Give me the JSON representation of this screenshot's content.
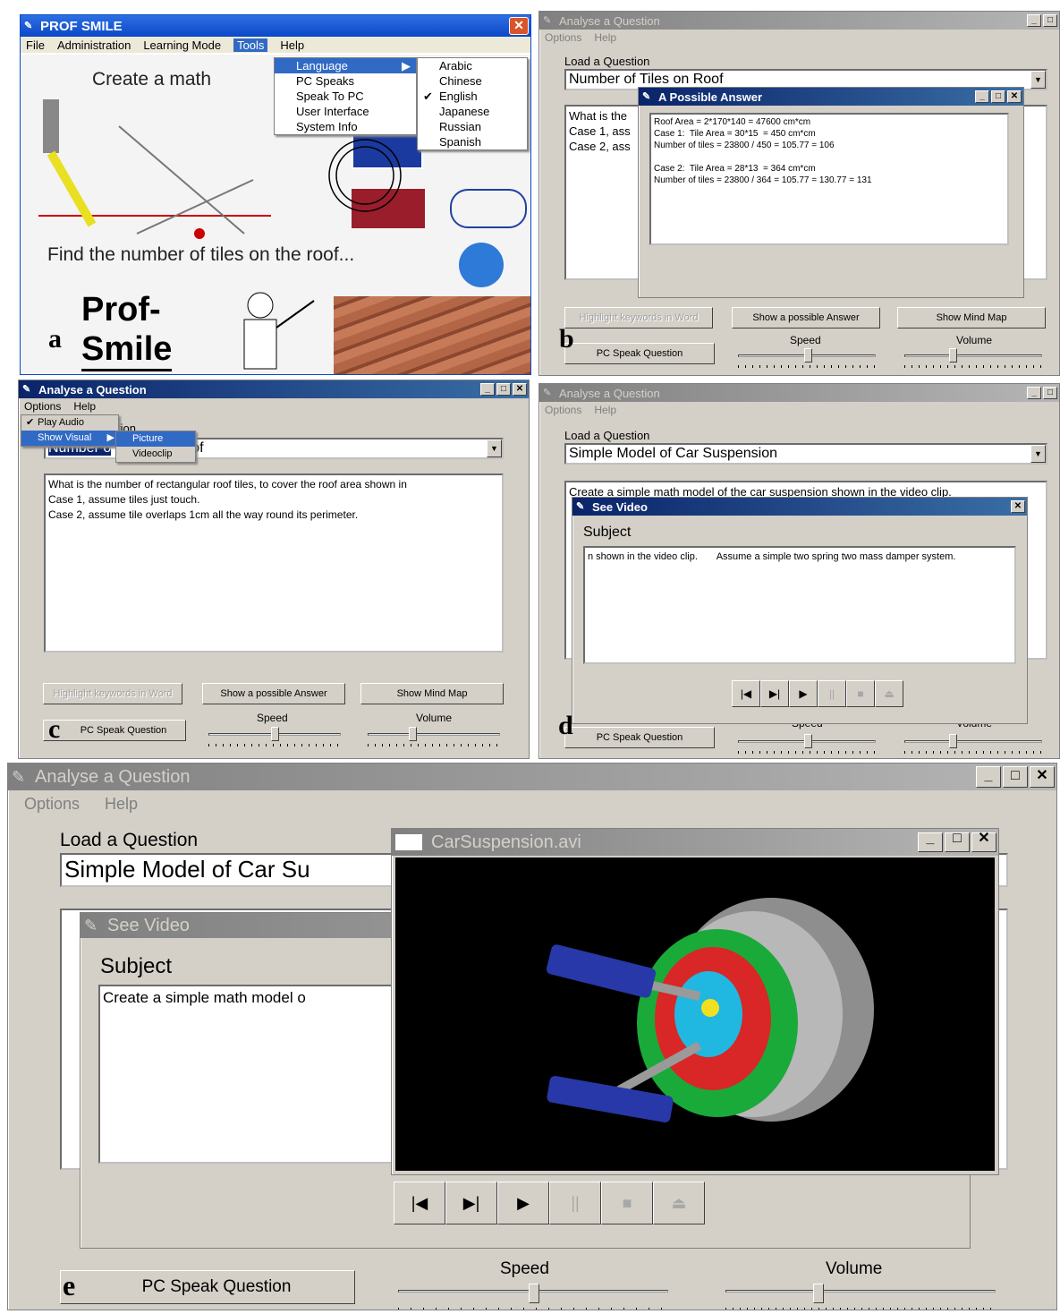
{
  "panel_a": {
    "letter": "a",
    "title": "PROF SMILE",
    "menu": [
      "File",
      "Administration",
      "Learning Mode",
      "Tools",
      "Help"
    ],
    "tools_menu": [
      "Language",
      "PC Speaks",
      "Speak To PC",
      "User Interface",
      "System Info"
    ],
    "language_menu": [
      "Arabic",
      "Chinese",
      "English",
      "Japanese",
      "Russian",
      "Spanish"
    ],
    "checked_language": "English",
    "bg_text_1": "Create a math",
    "bg_text_2": "Find the number of tiles on the roof...",
    "logo_line1": "Prof-",
    "logo_line2": "Smile"
  },
  "panel_b": {
    "letter": "b",
    "title": "Analyse a Question",
    "menu": [
      "Options",
      "Help"
    ],
    "load_label": "Load a Question",
    "combo_value": "Number of Tiles on Roof",
    "question_lines": "What is the\nCase 1, ass\nCase 2, ass",
    "dialog_title": "A Possible Answer",
    "answer_text": "Roof Area = 2*170*140 = 47600 cm*cm\nCase 1:  Tile Area = 30*15  = 450 cm*cm\nNumber of tiles = 23800 / 450 = 105.77 = 106\n\nCase 2:  Tile Area = 28*13  = 364 cm*cm\nNumber of tiles = 23800 / 364 = 105.77 = 130.77 = 131",
    "btn_highlight": "Highlight keywords in Word",
    "btn_answer": "Show a possible Answer",
    "btn_mindmap": "Show Mind Map",
    "btn_speak": "PC Speak Question",
    "speed_label": "Speed",
    "volume_label": "Volume"
  },
  "panel_c": {
    "letter": "c",
    "title": "Analyse a Question",
    "menu": [
      "Options",
      "Help"
    ],
    "options_menu": [
      "Play Audio",
      "Show Visual"
    ],
    "visual_menu": [
      "Picture",
      "Videoclip"
    ],
    "combo_value_visible": "Number o",
    "combo_tail": "of",
    "label_tail": "tion",
    "question_text": "What is the number of rectangular roof tiles, to cover the roof area shown in\nCase 1, assume tiles just touch.\nCase 2, assume tile overlaps 1cm all the way round its perimeter.",
    "btn_highlight": "Highlight keywords in Word",
    "btn_answer": "Show a possible Answer",
    "btn_mindmap": "Show Mind Map",
    "btn_speak": "PC Speak Question",
    "speed_label": "Speed",
    "volume_label": "Volume"
  },
  "panel_d": {
    "letter": "d",
    "title": "Analyse a Question",
    "menu": [
      "Options",
      "Help"
    ],
    "load_label": "Load a Question",
    "combo_value": "Simple Model of Car Suspension",
    "question_text": "Create a simple math model of the car suspension shown in the video clip.",
    "dialog_title": "See Video",
    "subject_label": "Subject",
    "subject_text": "n shown in the video clip.       Assume a simple two spring two mass damper system.",
    "btn_speak": "PC Speak Question",
    "speed_label": "Speed",
    "volume_label": "Volume"
  },
  "panel_e": {
    "letter": "e",
    "title": "Analyse a Question",
    "menu": [
      "Options",
      "Help"
    ],
    "load_label": "Load a Question",
    "combo_value": "Simple Model of Car Su",
    "see_video_title": "See Video",
    "subject_label": "Subject",
    "subject_text": "Create a simple math model o",
    "video_title": "CarSuspension.avi",
    "btn_speak": "PC Speak Question",
    "speed_label": "Speed",
    "volume_label": "Volume"
  },
  "colors": {
    "titlebar_active": "#0a246a",
    "dialog_bg": "#d4d0c8",
    "video_bg": "#000000"
  }
}
